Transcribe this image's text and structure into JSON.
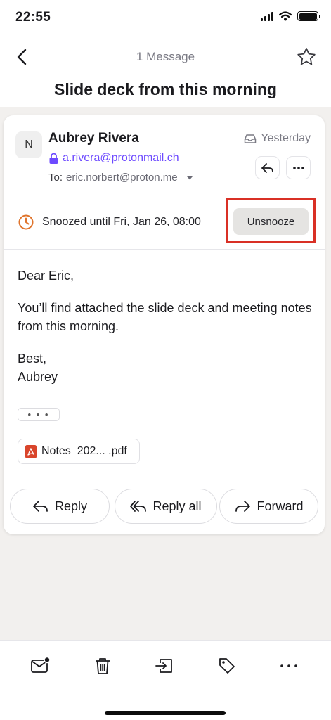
{
  "status_bar": {
    "time": "22:55"
  },
  "nav": {
    "count_label": "1 Message"
  },
  "subject": "Slide deck from this morning",
  "message": {
    "avatar_initial": "N",
    "sender_name": "Aubrey Rivera",
    "sender_email": "a.rivera@protonmail.ch",
    "to_label": "To:",
    "to_address": "eric.norbert@proton.me",
    "date": "Yesterday",
    "snooze_text": "Snoozed until Fri, Jan 26, 08:00",
    "unsnooze_label": "Unsnooze",
    "body": {
      "greeting": "Dear Eric,",
      "paragraph": "You’ll find attached the slide deck and meeting notes from this morning.",
      "signoff": "Best,",
      "signature": "Aubrey"
    },
    "more_dots": "• • •",
    "attachment_name": "Notes_202... .pdf"
  },
  "actions": {
    "reply": "Reply",
    "reply_all": "Reply all",
    "forward": "Forward"
  },
  "colors": {
    "accent": "#6d4aff",
    "snooze": "#e0742c",
    "highlight": "#d93025",
    "pdf": "#d9452b"
  }
}
